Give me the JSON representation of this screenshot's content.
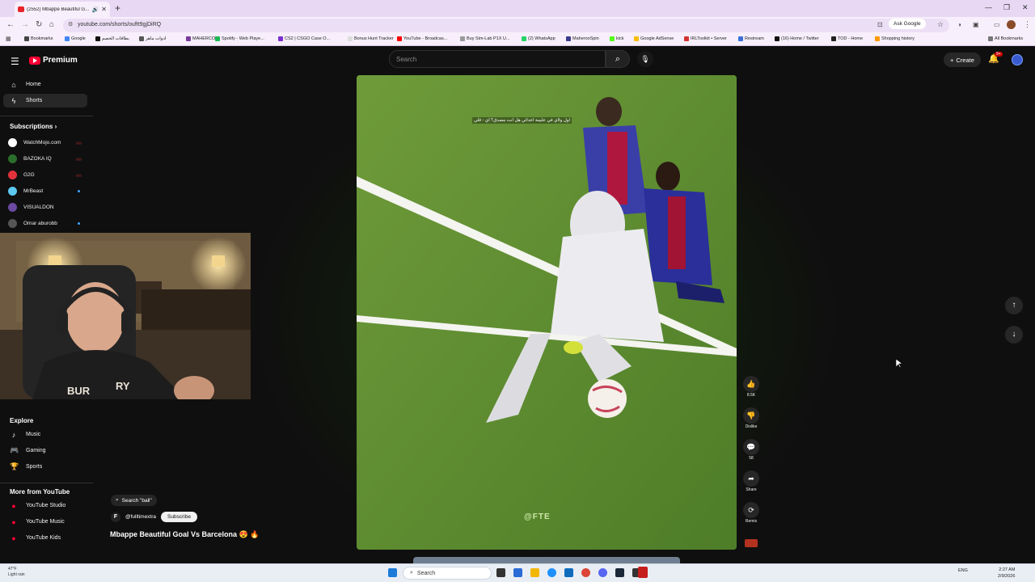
{
  "browser": {
    "tab_title": "(2552) Mbappe Beautiful G...",
    "new_tab": "+",
    "url": "youtube.com/shorts/ouftt9gjDiRQ",
    "ask_google": "Ask Google",
    "all_bookmarks": "All Bookmarks",
    "bookmarks": [
      {
        "label": "Bookmarks",
        "color": "#444444"
      },
      {
        "label": "Google",
        "color": "#4285f4"
      },
      {
        "label": "بطاقات الخصم",
        "color": "#111111"
      },
      {
        "label": "ادوات ماهر",
        "color": "#555555"
      },
      {
        "label": "MAHERCO",
        "color": "#7a3b9c"
      },
      {
        "label": "Spotify - Web Playe...",
        "color": "#1db954"
      },
      {
        "label": "CS2 | CSGO Case O...",
        "color": "#7b2fd0"
      },
      {
        "label": "Bonus Hunt Tracker",
        "color": "#dddddd"
      },
      {
        "label": "YouTube - Broadcas...",
        "color": "#ff0000"
      },
      {
        "label": "Buy Sim-Lab P1X U...",
        "color": "#999999"
      },
      {
        "label": "(2) WhatsApp",
        "color": "#25d366"
      },
      {
        "label": "MaherooSpin",
        "color": "#3b3b8c"
      },
      {
        "label": "kick",
        "color": "#53fc18"
      },
      {
        "label": "Google AdSense",
        "color": "#fbbc04"
      },
      {
        "label": "IRLToolkit • Server",
        "color": "#d33333"
      },
      {
        "label": "Restream",
        "color": "#3a6fd8"
      },
      {
        "label": "(16) Home / Twitter",
        "color": "#111111"
      },
      {
        "label": "TOD - Home",
        "color": "#222222"
      },
      {
        "label": "Shopping history",
        "color": "#ff9900"
      }
    ]
  },
  "header": {
    "brand": "Premium",
    "search_placeholder": "Search",
    "create_label": "Create",
    "notif_count": "9+"
  },
  "sidebar": {
    "home": "Home",
    "shorts": "Shorts",
    "subscriptions_title": "Subscriptions",
    "subscriptions": [
      {
        "name": "WatchMojo.com",
        "color": "#ffffff",
        "marker": "live"
      },
      {
        "name": "BAZOKA IQ",
        "color": "#2b6e2b",
        "marker": "live"
      },
      {
        "name": "G2G",
        "color": "#e2323c",
        "marker": "live"
      },
      {
        "name": "MrBeast",
        "color": "#5ec8f0",
        "marker": "dot"
      },
      {
        "name": "VISUALDON",
        "color": "#6b4aa0",
        "marker": "none"
      },
      {
        "name": "Omar aburobb",
        "color": "#555555",
        "marker": "dot"
      }
    ],
    "explore_title": "Explore",
    "explore": [
      "Music",
      "Gaming",
      "Sports"
    ],
    "more_title": "More from YouTube",
    "more": [
      "YouTube Studio",
      "YouTube Music",
      "YouTube Kids"
    ]
  },
  "webcam": {
    "shirt_text_1": "BUR",
    "shirt_text_2": "RY"
  },
  "video": {
    "caption": "اول ولاي في عليمة اعدائي هل انت مصدق؟ اي - قلي",
    "watermark": "@FTE",
    "search_chip": "Search \"ball\"",
    "channel_initial": "F",
    "channel": "@fulltimextra",
    "subscribe": "Subscribe",
    "title": "Mbappe Beautiful Goal Vs Barcelona 😍 🔥"
  },
  "actions": {
    "likes": "8.5K",
    "dislike": "Dislike",
    "comments": "58",
    "share": "Share",
    "remix": "Remix"
  },
  "taskbar": {
    "weather_temp": "47°F",
    "weather_desc": "Light rain",
    "search": "Search",
    "lang": "ENG",
    "time": "2:27 AM",
    "date": "2/9/2026"
  }
}
